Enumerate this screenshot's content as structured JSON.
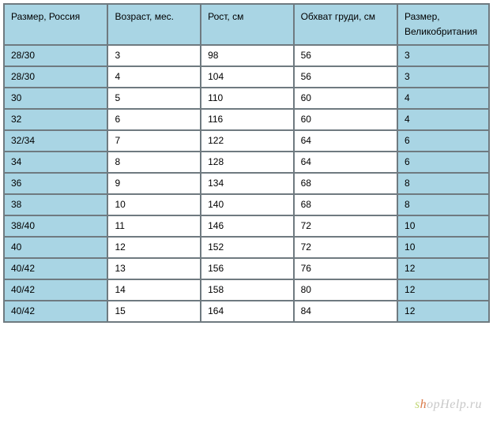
{
  "table": {
    "headers": [
      "Размер, Россия",
      "Возраст, мес.",
      "Рост, см",
      "Обхват груди, см",
      "Размер, Великобритания"
    ],
    "rows": [
      [
        "28/30",
        "3",
        "98",
        "56",
        "3"
      ],
      [
        "28/30",
        "4",
        "104",
        "56",
        "3"
      ],
      [
        "30",
        "5",
        "110",
        "60",
        "4"
      ],
      [
        "32",
        "6",
        "116",
        "60",
        "4"
      ],
      [
        "32/34",
        "7",
        "122",
        "64",
        "6"
      ],
      [
        "34",
        "8",
        "128",
        "64",
        "6"
      ],
      [
        "36",
        "9",
        "134",
        "68",
        "8"
      ],
      [
        "38",
        "10",
        "140",
        "68",
        "8"
      ],
      [
        "38/40",
        "11",
        "146",
        "72",
        "10"
      ],
      [
        "40",
        "12",
        "152",
        "72",
        "10"
      ],
      [
        "40/42",
        "13",
        "156",
        "76",
        "12"
      ],
      [
        "40/42",
        "14",
        "158",
        "80",
        "12"
      ],
      [
        "40/42",
        "15",
        "164",
        "84",
        "12"
      ]
    ]
  },
  "watermark": {
    "prefix": "s",
    "mid": "h",
    "suffix": "opHelp.ru"
  }
}
